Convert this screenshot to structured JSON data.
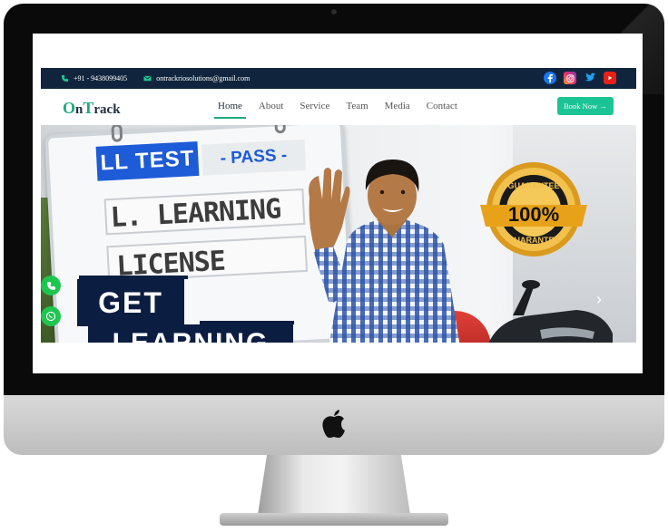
{
  "topbar": {
    "phone": "+91 - 9438099405",
    "email": "ontrackriosolutions@gmail.com",
    "social": [
      "facebook-icon",
      "instagram-icon",
      "twitter-icon",
      "youtube-icon"
    ]
  },
  "nav": {
    "logo_o": "O",
    "logo_n": "n",
    "logo_t": "T",
    "logo_rest": "rack",
    "items": [
      {
        "label": "Home",
        "active": true
      },
      {
        "label": "About",
        "active": false
      },
      {
        "label": "Service",
        "active": false
      },
      {
        "label": "Team",
        "active": false
      },
      {
        "label": "Media",
        "active": false
      },
      {
        "label": "Contact",
        "active": false
      }
    ],
    "cta_label": "Book Now →"
  },
  "hero": {
    "ll_test": "LL TEST",
    "pass": "- PASS -",
    "line1": "L. LEARNING",
    "line2": "LICENSE",
    "get": "GET",
    "learning": "LEARNING",
    "badge_top": "GUARANTEE",
    "badge_value": "100%",
    "badge_bottom": "GUARANTEE",
    "next_arrow": "›"
  },
  "colors": {
    "accent": "#1ec694",
    "topbar_bg": "#10253d",
    "brand_dark": "#0c1d42",
    "brand_blue": "#1e5bd6",
    "gold": "#e8a21a"
  }
}
